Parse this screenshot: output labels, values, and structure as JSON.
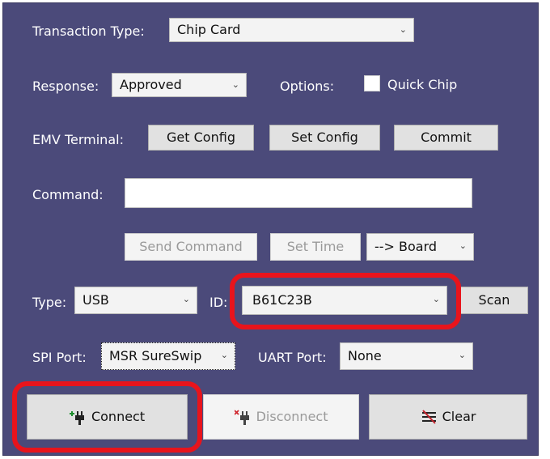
{
  "transaction": {
    "label": "Transaction Type:",
    "value": "Chip Card"
  },
  "response": {
    "label": "Response:",
    "value": "Approved"
  },
  "options": {
    "label": "Options:",
    "quick_chip_label": "Quick Chip",
    "quick_chip_checked": false
  },
  "emv": {
    "label": "EMV Terminal:",
    "get_config": "Get Config",
    "set_config": "Set Config",
    "commit": "Commit"
  },
  "command": {
    "label": "Command:",
    "value": ""
  },
  "actions": {
    "send_command": "Send Command",
    "set_time": "Set Time",
    "target_value": "--> Board"
  },
  "connection": {
    "type_label": "Type:",
    "type_value": "USB",
    "id_label": "ID:",
    "id_value": "B61C23B",
    "scan": "Scan"
  },
  "ports": {
    "spi_label": "SPI Port:",
    "spi_value": "MSR SureSwip",
    "uart_label": "UART Port:",
    "uart_value": "None"
  },
  "bottom": {
    "connect": "Connect",
    "disconnect": "Disconnect",
    "clear": "Clear"
  },
  "colors": {
    "panel_bg": "#4b4a7a",
    "highlight": "#e8141c"
  }
}
